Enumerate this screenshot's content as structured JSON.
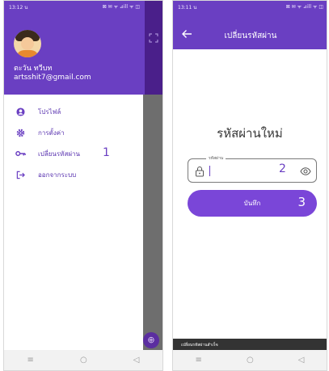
{
  "left_screen": {
    "status_bar": {
      "time": "13:12 น",
      "indicators": "⊠ ✉ ᯤ ⊿ill ᯤ ◫"
    },
    "drawer": {
      "user_name": "ตะวัน ทวีบท",
      "user_email": "artsshit7@gmail.com",
      "menu_items": [
        {
          "label": "โปรไฟล์",
          "icon": "account-circle-icon"
        },
        {
          "label": "การตั้งค่า",
          "icon": "gear-icon"
        },
        {
          "label": "เปลี่ยนรหัสผ่าน",
          "icon": "key-icon"
        },
        {
          "label": "ออกจากระบบ",
          "icon": "logout-icon"
        }
      ],
      "step_marker": "1"
    },
    "nav_bar": {
      "menu": "≡",
      "home": "○",
      "back": "◁"
    }
  },
  "right_screen": {
    "status_bar": {
      "time": "13:11 น",
      "indicators": "⊠ ✉ ᯤ ⊿ill ᯤ ◫"
    },
    "app_bar": {
      "title": "เปลี่ยนรหัสผ่าน"
    },
    "heading": "รหัสผ่านใหม่",
    "password_field": {
      "label": "รหัสผ่าน",
      "value": "",
      "step_marker": "2"
    },
    "save_button": {
      "label": "บันทึก",
      "step_marker": "3"
    },
    "toast": "เปลี่ยนรหัสผ่านสำเร็จ",
    "nav_bar": {
      "menu": "≡",
      "home": "○",
      "back": "◁"
    }
  },
  "colors": {
    "primary": "#6a3fc2",
    "button": "#7a46d8",
    "menu_text": "#5a34b0",
    "scrim": "#6e6e6e"
  }
}
